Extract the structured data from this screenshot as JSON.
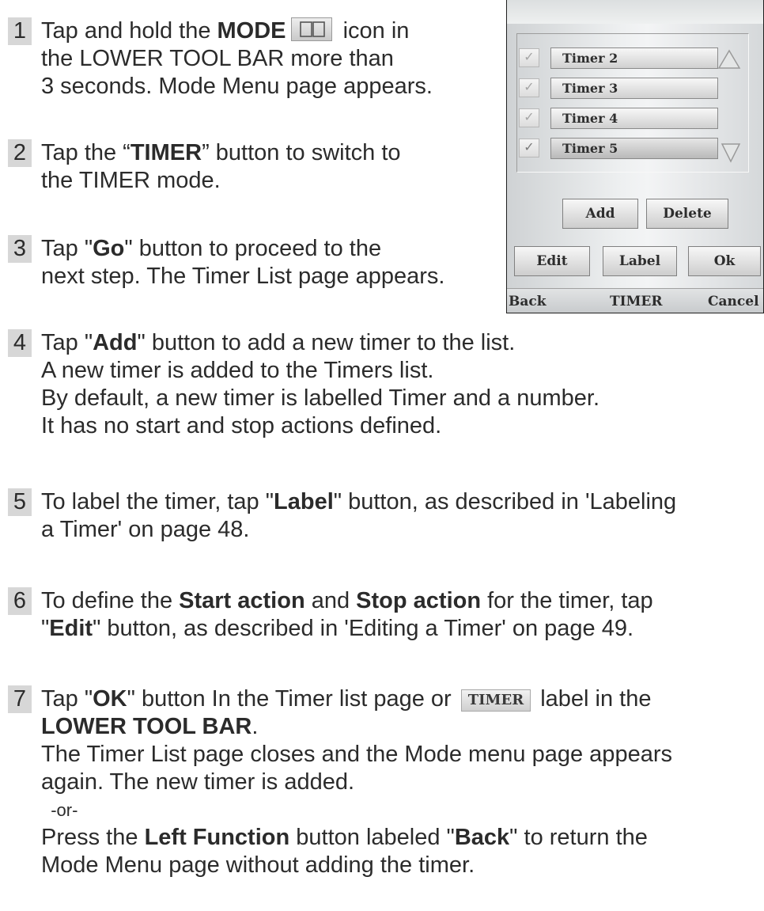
{
  "steps": [
    {
      "num": "1",
      "lines": [
        {
          "a": "Tap and hold the ",
          "b": "MODE",
          "c": " icon in"
        },
        {
          "t": "the LOWER TOOL BAR more than"
        },
        {
          "t": "3 seconds. Mode Menu page appears."
        }
      ]
    },
    {
      "num": "2",
      "lines": [
        {
          "a": "Tap the “",
          "b": "TIMER",
          "c": "” button to switch to"
        },
        {
          "t": "the TIMER mode."
        }
      ]
    },
    {
      "num": "3",
      "lines": [
        {
          "a": "Tap \"",
          "b": "Go",
          "c": "\" button to proceed to the"
        },
        {
          "t": "next step. The Timer List page appears."
        }
      ]
    },
    {
      "num": "4",
      "lines": [
        {
          "a": "Tap \"",
          "b": "Add",
          "c": "\" button to add a new timer to the list."
        },
        {
          "t": "A new timer is added to the Timers list."
        },
        {
          "t": "By default, a new timer is labelled Timer and a number."
        },
        {
          "t": "It has no start and stop actions defined."
        }
      ]
    },
    {
      "num": "5",
      "lines": [
        {
          "a": "To label the timer, tap \"",
          "b": "Label",
          "c": "\" button, as described in 'Labeling"
        },
        {
          "t": "a Timer' on page 48."
        }
      ]
    },
    {
      "num": "6",
      "lines": [
        {
          "a": "To define the ",
          "b": "Start action",
          "c": " and ",
          "d": "Stop action",
          "e": " for the timer, tap"
        },
        {
          "a": "\"",
          "b": "Edit",
          "c": "\" button, as described in 'Editing a Timer' on page 49."
        }
      ]
    },
    {
      "num": "7",
      "lines": [
        {
          "a": "Tap \"",
          "b": "OK",
          "c": "\" button In the Timer list page or ",
          "chip": "TIMER",
          "d": " label in the"
        },
        {
          "b": "LOWER TOOL BAR",
          "c": "."
        },
        {
          "t": "The Timer List page closes and the Mode menu page appears"
        },
        {
          "t": "again. The new timer is added."
        },
        {
          "t": "  -or-"
        },
        {
          "a": "Press the ",
          "b": "Left Function",
          "c": " button labeled \"",
          "d": "Back",
          "e": "\" to return the"
        },
        {
          "t": "Mode Menu page without adding the timer."
        }
      ]
    }
  ],
  "device": {
    "timers": [
      {
        "label": "Timer 2",
        "checked": false
      },
      {
        "label": "Timer 3",
        "checked": false
      },
      {
        "label": "Timer 4",
        "checked": false
      },
      {
        "label": "Timer 5",
        "checked": true
      }
    ],
    "check_glyph": "✓",
    "add_label": "Add",
    "delete_label": "Delete",
    "edit_label": "Edit",
    "label_label": "Label",
    "ok_label": "Ok",
    "toolbar": {
      "left": "Back",
      "center": "TIMER",
      "right": "Cancel"
    }
  }
}
